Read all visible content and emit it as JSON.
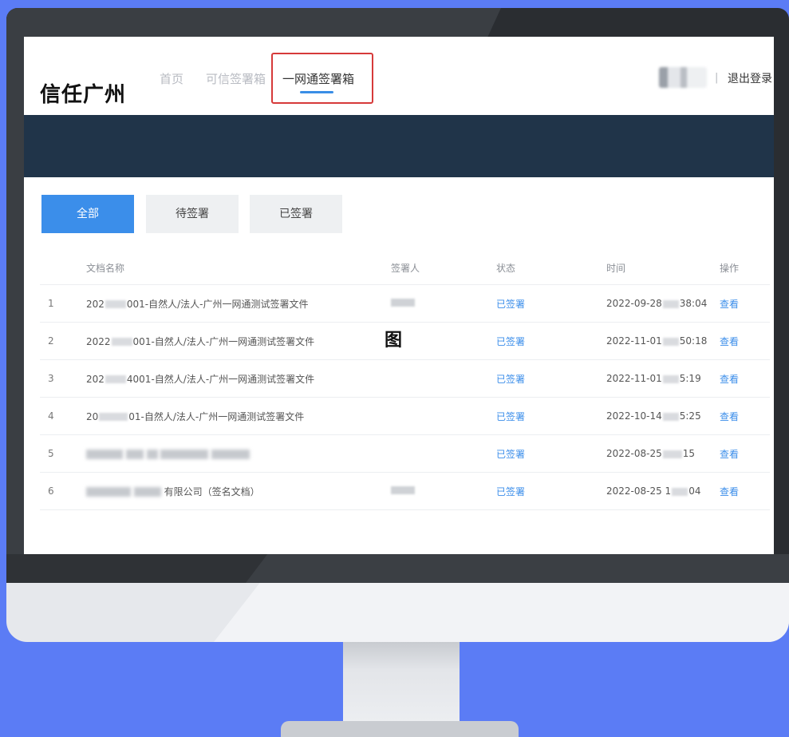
{
  "header": {
    "brand": "信任广州",
    "nav": [
      {
        "label": "首页"
      },
      {
        "label": "可信签署箱"
      },
      {
        "label": "一网通签署箱"
      }
    ],
    "user_separator": "|",
    "logout_label": "退出登录"
  },
  "tabs": [
    {
      "label": "全部",
      "active": true
    },
    {
      "label": "待签署",
      "active": false
    },
    {
      "label": "已签署",
      "active": false
    }
  ],
  "table": {
    "columns": [
      "文档名称",
      "签署人",
      "状态",
      "时间",
      "操作"
    ],
    "rows": [
      {
        "index": "1",
        "name_prefix": "202",
        "name_suffix": "001-自然人/法人-广州一网通测试签署文件",
        "status": "已签署",
        "time_prefix": "2022-09-28",
        "time_suffix": "38:04",
        "action": "查看"
      },
      {
        "index": "2",
        "name_prefix": "2022",
        "name_suffix": "001-自然人/法人-广州一网通测试签署文件",
        "status": "已签署",
        "time_prefix": "2022-11-01",
        "time_suffix": "50:18",
        "action": "查看"
      },
      {
        "index": "3",
        "name_prefix": "202",
        "name_suffix": "4001-自然人/法人-广州一网通测试签署文件",
        "status": "已签署",
        "time_prefix": "2022-11-01",
        "time_suffix": "5:19",
        "action": "查看"
      },
      {
        "index": "4",
        "name_prefix": "20",
        "name_suffix": "01-自然人/法人-广州一网通测试签署文件",
        "status": "已签署",
        "time_prefix": "2022-10-14",
        "time_suffix": "5:25",
        "action": "查看"
      },
      {
        "index": "5",
        "name_prefix": "",
        "name_suffix": "",
        "status": "已签署",
        "time_prefix": "2022-08-25",
        "time_suffix": "15",
        "action": "查看"
      },
      {
        "index": "6",
        "name_prefix": "",
        "name_suffix": "有限公司（签名文档）",
        "status": "已签署",
        "time_prefix": "2022-08-25 1",
        "time_suffix": "04",
        "action": "查看"
      }
    ]
  },
  "overlay_mark": "图",
  "colors": {
    "background": "#5b7cf5",
    "banner": "#203449",
    "accent": "#3b8eea",
    "highlight_box": "#d63a3a"
  }
}
